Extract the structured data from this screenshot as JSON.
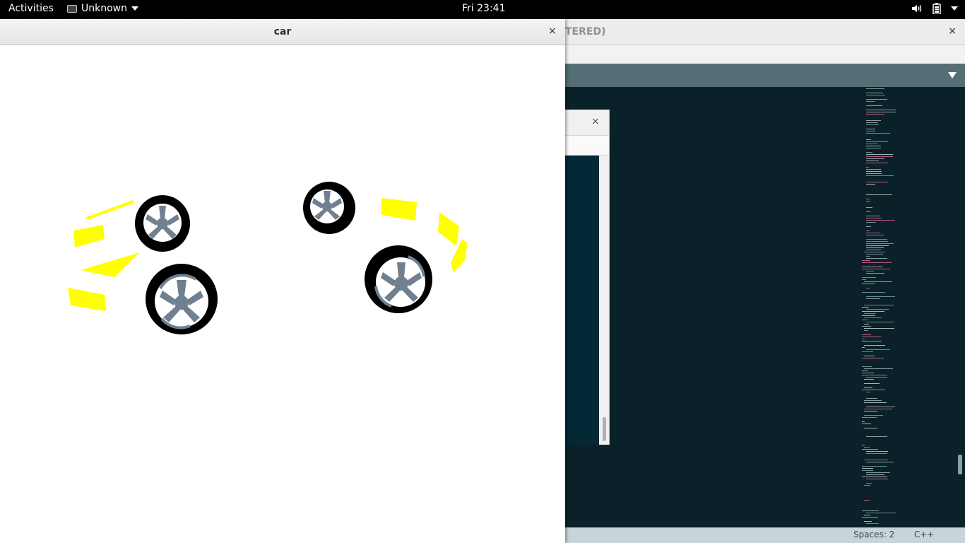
{
  "topbar": {
    "activities": "Activities",
    "app_menu": "Unknown",
    "clock": "Fri 23:41",
    "icons": [
      "volume-icon",
      "battery-icon",
      "system-menu-icon"
    ]
  },
  "editor": {
    "title_fragment": "TERED)",
    "close": "×",
    "status_spaces": "Spaces: 2",
    "status_language": "C++"
  },
  "dialog": {
    "close": "×"
  },
  "car_window": {
    "title": "car",
    "close": "×"
  },
  "colors": {
    "panel": "#000000",
    "editor_bg": "#0a2129",
    "tabbar": "#546e75",
    "car_body": "#ffff00",
    "tire": "#000000",
    "hubcap": "#708090",
    "rim_highlight": "#ffffff"
  }
}
